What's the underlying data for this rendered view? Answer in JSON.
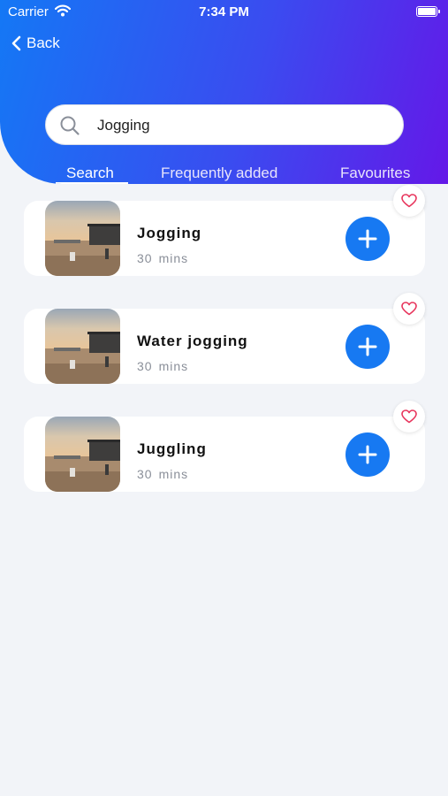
{
  "status_bar": {
    "carrier": "Carrier",
    "time": "7:34 PM"
  },
  "nav": {
    "back_label": "Back"
  },
  "search": {
    "value": "Jogging",
    "placeholder": ""
  },
  "tabs": [
    {
      "label": "Search",
      "active": true
    },
    {
      "label": "Frequently added",
      "active": false
    },
    {
      "label": "Favourites",
      "active": false
    }
  ],
  "results": [
    {
      "title": "Jogging",
      "duration": "30",
      "unit": "mins",
      "favourite": false
    },
    {
      "title": "Water jogging",
      "duration": "30",
      "unit": "mins",
      "favourite": false
    },
    {
      "title": "Juggling",
      "duration": "30",
      "unit": "mins",
      "favourite": false
    }
  ],
  "colors": {
    "header_gradient_start": "#1478f5",
    "header_gradient_end": "#6418e8",
    "accent": "#1779f2",
    "heart": "#e8365d",
    "background": "#f2f4f8"
  },
  "icons": [
    "wifi-icon",
    "battery-icon",
    "chevron-left-icon",
    "search-icon",
    "plus-icon",
    "heart-icon"
  ]
}
